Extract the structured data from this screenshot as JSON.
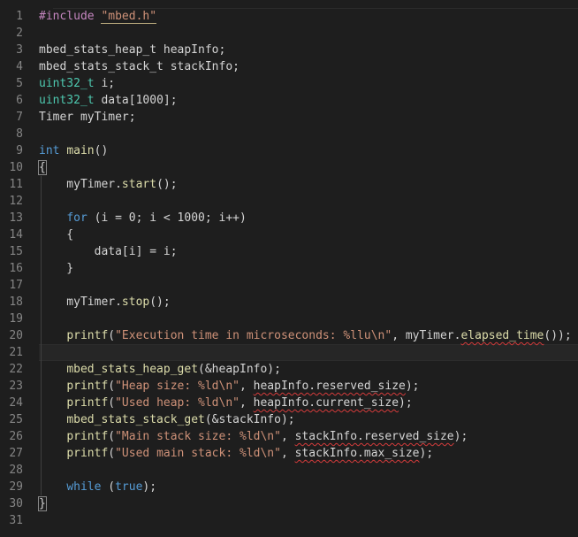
{
  "editor": {
    "line_numbers": [
      "1",
      "2",
      "3",
      "4",
      "5",
      "6",
      "7",
      "8",
      "9",
      "10",
      "11",
      "12",
      "13",
      "14",
      "15",
      "16",
      "17",
      "18",
      "19",
      "20",
      "21",
      "22",
      "23",
      "24",
      "25",
      "26",
      "27",
      "28",
      "29",
      "30",
      "31"
    ],
    "current_line": 21,
    "lines": [
      [
        {
          "t": "pre",
          "v": "#include "
        },
        {
          "t": "str",
          "v": "\"mbed.h\"",
          "u": "inc"
        }
      ],
      [],
      [
        {
          "t": "plain",
          "v": "mbed_stats_heap_t heapInfo;"
        }
      ],
      [
        {
          "t": "plain",
          "v": "mbed_stats_stack_t stackInfo;"
        }
      ],
      [
        {
          "t": "type",
          "v": "uint32_t"
        },
        {
          "t": "plain",
          "v": " i;"
        }
      ],
      [
        {
          "t": "type",
          "v": "uint32_t"
        },
        {
          "t": "plain",
          "v": " data[1000];"
        }
      ],
      [
        {
          "t": "plain",
          "v": "Timer myTimer;"
        }
      ],
      [],
      [
        {
          "t": "kw",
          "v": "int"
        },
        {
          "t": "plain",
          "v": " "
        },
        {
          "t": "fn",
          "v": "main"
        },
        {
          "t": "plain",
          "v": "()"
        }
      ],
      [
        {
          "t": "plain",
          "v": "{",
          "u": "box"
        }
      ],
      [
        {
          "t": "plain",
          "v": "    myTimer."
        },
        {
          "t": "fn",
          "v": "start"
        },
        {
          "t": "plain",
          "v": "();"
        }
      ],
      [],
      [
        {
          "t": "plain",
          "v": "    "
        },
        {
          "t": "kw",
          "v": "for"
        },
        {
          "t": "plain",
          "v": " (i = 0; i < 1000; i++)"
        }
      ],
      [
        {
          "t": "plain",
          "v": "    {"
        }
      ],
      [
        {
          "t": "plain",
          "v": "        data[i] = i;"
        }
      ],
      [
        {
          "t": "plain",
          "v": "    }"
        }
      ],
      [],
      [
        {
          "t": "plain",
          "v": "    myTimer."
        },
        {
          "t": "fn",
          "v": "stop"
        },
        {
          "t": "plain",
          "v": "();"
        }
      ],
      [],
      [
        {
          "t": "plain",
          "v": "    "
        },
        {
          "t": "fn",
          "v": "printf"
        },
        {
          "t": "plain",
          "v": "("
        },
        {
          "t": "str",
          "v": "\"Execution time in microseconds: %llu\\n\""
        },
        {
          "t": "plain",
          "v": ", myTimer."
        },
        {
          "t": "fn",
          "v": "elapsed_time",
          "u": "squig"
        },
        {
          "t": "plain",
          "v": "());"
        }
      ],
      [],
      [
        {
          "t": "plain",
          "v": "    "
        },
        {
          "t": "fn",
          "v": "mbed_stats_heap_get"
        },
        {
          "t": "plain",
          "v": "(&heapInfo);"
        }
      ],
      [
        {
          "t": "plain",
          "v": "    "
        },
        {
          "t": "fn",
          "v": "printf"
        },
        {
          "t": "plain",
          "v": "("
        },
        {
          "t": "str",
          "v": "\"Heap size: %ld\\n\""
        },
        {
          "t": "plain",
          "v": ", "
        },
        {
          "t": "plain",
          "v": "heapInfo.reserved_size",
          "u": "squig"
        },
        {
          "t": "plain",
          "v": ");"
        }
      ],
      [
        {
          "t": "plain",
          "v": "    "
        },
        {
          "t": "fn",
          "v": "printf"
        },
        {
          "t": "plain",
          "v": "("
        },
        {
          "t": "str",
          "v": "\"Used heap: %ld\\n\""
        },
        {
          "t": "plain",
          "v": ", "
        },
        {
          "t": "plain",
          "v": "heapInfo.current_size",
          "u": "squig"
        },
        {
          "t": "plain",
          "v": ");"
        }
      ],
      [
        {
          "t": "plain",
          "v": "    "
        },
        {
          "t": "fn",
          "v": "mbed_stats_stack_get"
        },
        {
          "t": "plain",
          "v": "(&stackInfo);"
        }
      ],
      [
        {
          "t": "plain",
          "v": "    "
        },
        {
          "t": "fn",
          "v": "printf"
        },
        {
          "t": "plain",
          "v": "("
        },
        {
          "t": "str",
          "v": "\"Main stack size: %ld\\n\""
        },
        {
          "t": "plain",
          "v": ", "
        },
        {
          "t": "plain",
          "v": "stackInfo.reserved_size",
          "u": "squig"
        },
        {
          "t": "plain",
          "v": ");"
        }
      ],
      [
        {
          "t": "plain",
          "v": "    "
        },
        {
          "t": "fn",
          "v": "printf"
        },
        {
          "t": "plain",
          "v": "("
        },
        {
          "t": "str",
          "v": "\"Used main stack: %ld\\n\""
        },
        {
          "t": "plain",
          "v": ", "
        },
        {
          "t": "plain",
          "v": "stackInfo.max_size",
          "u": "squig"
        },
        {
          "t": "plain",
          "v": ");"
        }
      ],
      [],
      [
        {
          "t": "plain",
          "v": "    "
        },
        {
          "t": "kw",
          "v": "while"
        },
        {
          "t": "plain",
          "v": " ("
        },
        {
          "t": "kw",
          "v": "true"
        },
        {
          "t": "plain",
          "v": ");"
        }
      ],
      [
        {
          "t": "plain",
          "v": "}",
          "u": "box"
        }
      ],
      []
    ]
  },
  "colors": {
    "background": "#1e1e1e",
    "line_number": "#858585",
    "preprocessor": "#c586c0",
    "string": "#ce9178",
    "keyword": "#569cd6",
    "type": "#4ec9b0",
    "function": "#dcdcaa",
    "plain": "#d4d4d4",
    "error_squiggle": "#d43b3b"
  }
}
